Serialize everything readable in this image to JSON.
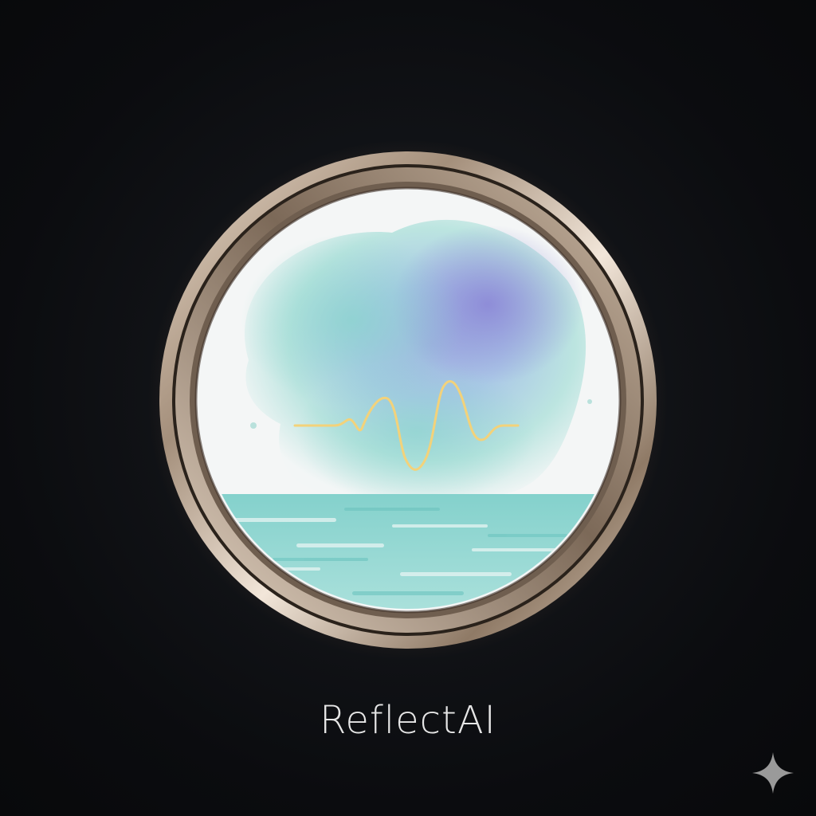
{
  "brand": {
    "name": "ReflectAI"
  },
  "emblem": {
    "ring_color": "#b9a896",
    "ring_highlight": "#efe2d4",
    "glow_color": "#f3b77a",
    "sky_colors": [
      "#aee2dc",
      "#8fd2cc",
      "#9aa8e0",
      "#7a6fd0"
    ],
    "sea_color": "#7fd0cc",
    "wave_line_color": "#f3d27a",
    "icons": [
      "watercolor-scene",
      "waveform-icon",
      "sea-reflection"
    ]
  },
  "corner_icon": "sparkle-icon"
}
